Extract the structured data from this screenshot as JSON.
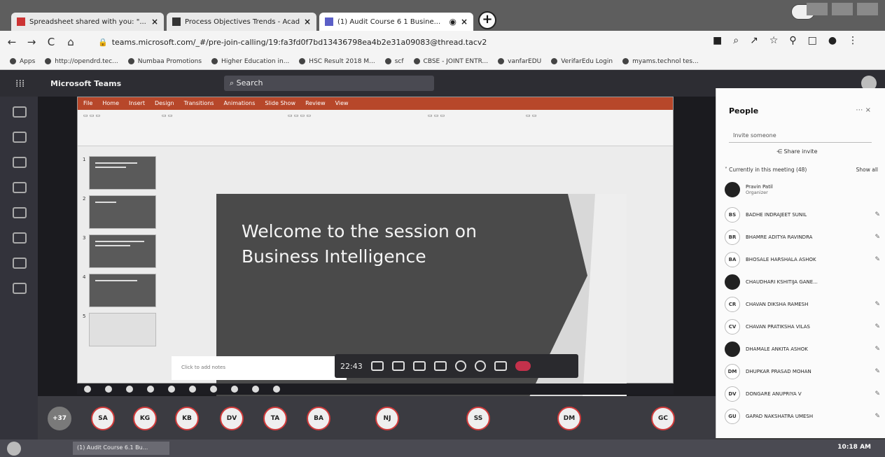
{
  "browser": {
    "tabs": [
      {
        "title": "Spreadsheet shared with you: \"...",
        "icon": "gmail-icon"
      },
      {
        "title": "Process Objectives Trends - Acad...",
        "icon": "doc-icon"
      },
      {
        "title": "(1) Audit Course 6 1 Busine...",
        "icon": "teams-icon"
      }
    ],
    "new_tab": "+",
    "url": "teams.microsoft.com/_#/pre-join-calling/19:fa3fd0f7bd13436798ea4b2e31a09083@thread.tacv2",
    "bookmarks": [
      "Apps",
      "http://opendrd.tec...",
      "Numbaa Promotions",
      "Higher Education in...",
      "HSC Result 2018 M...",
      "scf",
      "CBSE - JOINT ENTR...",
      "vanfarEDU",
      "VerifarEdu Login",
      "myams.technol tes..."
    ]
  },
  "teams": {
    "app_name": "Microsoft Teams",
    "search_placeholder": "Search",
    "slide": {
      "title_line1": "Welcome to the session on",
      "title_line2": "Business Intelligence"
    },
    "notes_placeholder": "Click to add notes",
    "meeting_timer": "22:43",
    "participants_strip": [
      "+37",
      "SA",
      "KG",
      "KB",
      "DV",
      "TA",
      "BA",
      "NJ",
      "SS",
      "DM",
      "GC"
    ]
  },
  "people_panel": {
    "title": "People",
    "invite_placeholder": "Invite someone",
    "share_invite": "Share invite",
    "current_label": "Currently in this meeting (48)",
    "show_all": "Show all",
    "people": [
      {
        "initials": "",
        "name": "Pravin Patil",
        "role": "Organizer",
        "dark": true
      },
      {
        "initials": "BS",
        "name": "BADHE INDRAJEET SUNIL",
        "role": ""
      },
      {
        "initials": "BR",
        "name": "BHAMRE ADITYA RAVINDRA",
        "role": ""
      },
      {
        "initials": "BA",
        "name": "BHOSALE HARSHALA ASHOK",
        "role": ""
      },
      {
        "initials": "",
        "name": "CHAUDHARI KSHITIJA GANE...",
        "role": "",
        "dark": true
      },
      {
        "initials": "CR",
        "name": "CHAVAN DIKSHA RAMESH",
        "role": ""
      },
      {
        "initials": "CV",
        "name": "CHAVAN PRATIKSHA VILAS",
        "role": ""
      },
      {
        "initials": "",
        "name": "DHAMALE ANKITA ASHOK",
        "role": "",
        "dark": true
      },
      {
        "initials": "DM",
        "name": "DHUPKAR PRASAD MOHAN",
        "role": ""
      },
      {
        "initials": "DV",
        "name": "DONGARE ANUPRIYA V",
        "role": ""
      },
      {
        "initials": "GU",
        "name": "GAPAD NAKSHATRA UMESH",
        "role": ""
      }
    ]
  },
  "taskbar": {
    "active_app": "(1) Audit Course 6.1 Bu...",
    "time": "10:18 AM"
  }
}
